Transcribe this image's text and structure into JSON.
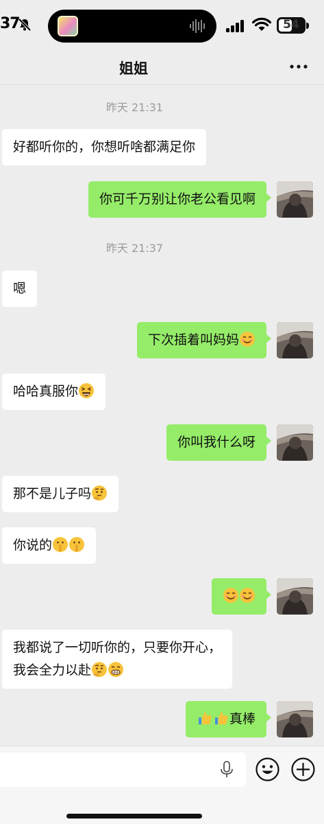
{
  "status_bar": {
    "time": "37",
    "battery": "54",
    "battery_level": 0.54
  },
  "header": {
    "title": "姐姐",
    "more_icon": "more-horizontal-icon"
  },
  "timestamps": [
    "昨天 21:31",
    "昨天 21:37"
  ],
  "messages": [
    {
      "side": "in",
      "text": "好都听你的，你想听啥都满足你"
    },
    {
      "side": "out",
      "text": "你可千万别让你老公看见啊"
    },
    {
      "side": "in",
      "text": "嗯"
    },
    {
      "side": "out",
      "text": "下次插着叫妈妈",
      "emojis": [
        "smiling-blush-emoji"
      ]
    },
    {
      "side": "in",
      "text": "哈哈真服你",
      "emojis": [
        "laughing-squint-emoji"
      ]
    },
    {
      "side": "out",
      "text": "你叫我什么呀"
    },
    {
      "side": "in",
      "text": "那不是儿子吗",
      "emojis": [
        "thinking-emoji"
      ]
    },
    {
      "side": "in",
      "text": "你说的",
      "emojis": [
        "shushing-emoji",
        "shushing-emoji"
      ]
    },
    {
      "side": "out",
      "text": "",
      "emojis": [
        "smiling-blush-emoji",
        "smiling-blush-emoji"
      ]
    },
    {
      "side": "in",
      "lines": [
        "我都说了一切听你的，只要你开心，",
        "我会全力以赴"
      ],
      "emojis": [
        "thinking-emoji",
        "grinning-teeth-emoji"
      ]
    },
    {
      "side": "out",
      "text": "真棒",
      "emojis": [
        "thumbs-up-emoji",
        "thumbs-up-emoji"
      ]
    }
  ],
  "input_bar": {
    "placeholder": "",
    "icons": [
      "microphone-icon",
      "emoji-face-icon",
      "plus-circle-icon"
    ]
  },
  "colors": {
    "background": "#ededed",
    "incoming_bubble": "#ffffff",
    "outgoing_bubble": "#95ec69",
    "timestamp_text": "#9b9b9b"
  }
}
